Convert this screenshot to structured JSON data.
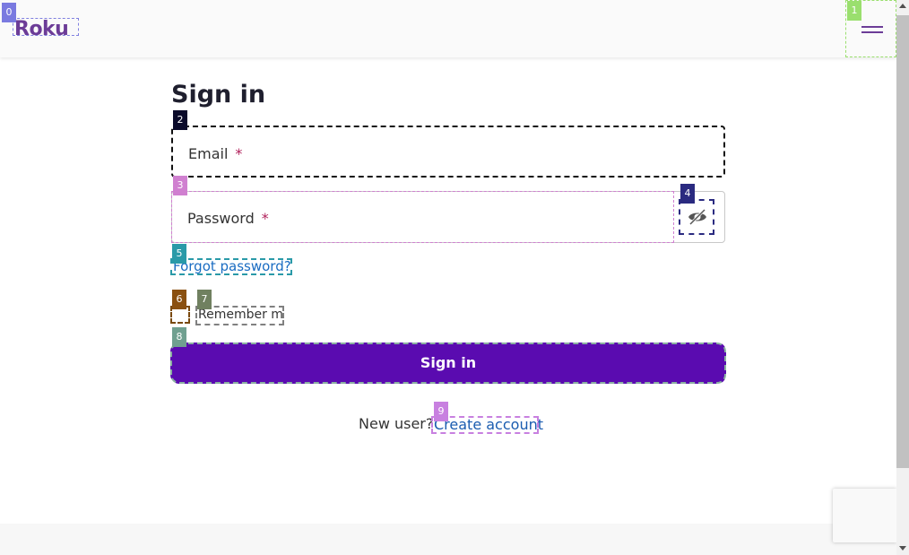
{
  "header": {
    "logo_text": "Roku",
    "brand_color": "#6c3c97",
    "menu_icon": "hamburger-icon"
  },
  "form": {
    "title": "Sign in",
    "email_label": "Email",
    "password_label": "Password",
    "required_mark": "*",
    "toggle_icon": "eye-slash-icon",
    "forgot_link": "Forgot password?",
    "remember_label": "Remember me",
    "submit_label": "Sign in",
    "submit_color": "#5a0bb0",
    "new_user_text": "New user?",
    "create_link": "Create account"
  },
  "annotations": {
    "tags": [
      "0",
      "1",
      "2",
      "3",
      "4",
      "5",
      "6",
      "7",
      "8",
      "9"
    ]
  }
}
